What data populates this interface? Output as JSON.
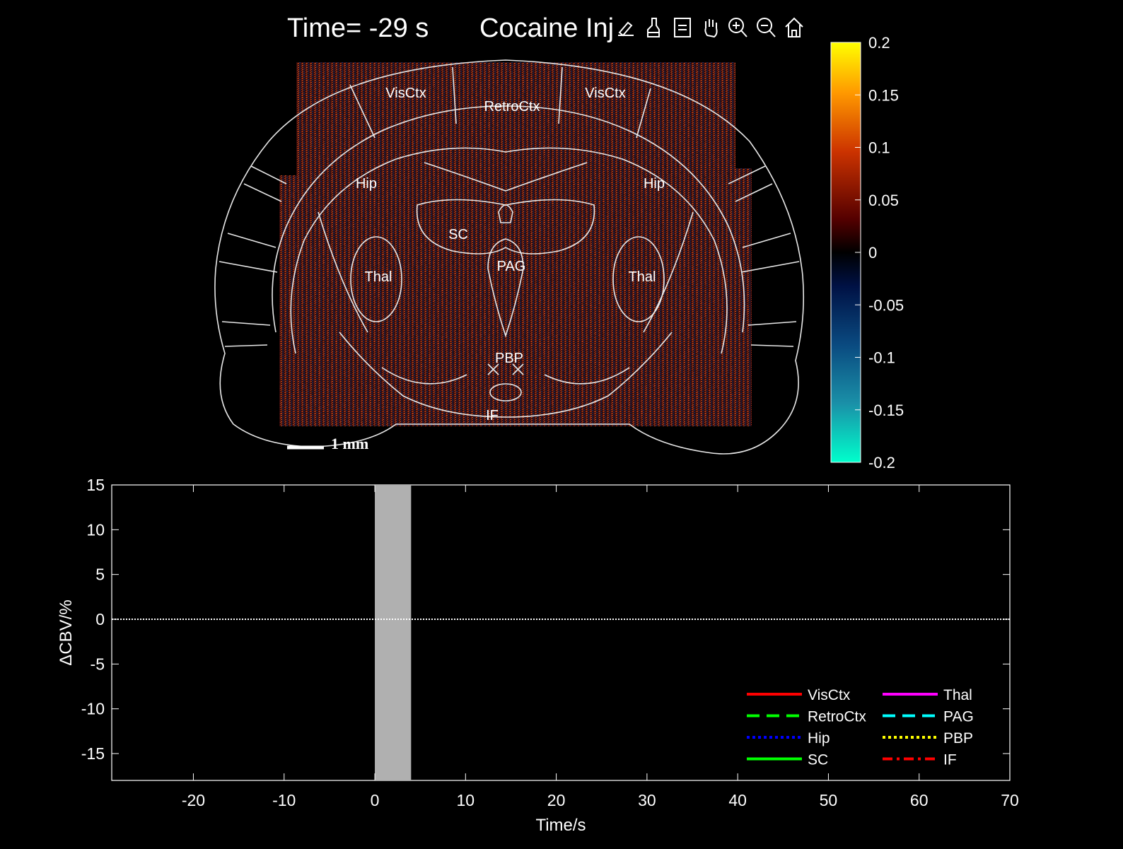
{
  "header": {
    "time_label": "Time= -29 s",
    "title": "Cocaine Inj"
  },
  "toolbar": {
    "icons": [
      "annotate-icon",
      "brush-icon",
      "datatip-icon",
      "pan-hand-icon",
      "zoom-in-icon",
      "zoom-out-icon",
      "home-icon"
    ]
  },
  "brain_map": {
    "regions": [
      "VisCtx",
      "RetroCtx",
      "VisCtx",
      "Hip",
      "Hip",
      "SC",
      "PAG",
      "Thal",
      "Thal",
      "PBP",
      "IF"
    ],
    "scale_bar": "1 mm"
  },
  "colorbar": {
    "min": -0.2,
    "max": 0.2,
    "ticks": [
      "0.2",
      "0.15",
      "0.1",
      "0.05",
      "0",
      "-0.05",
      "-0.1",
      "-0.15",
      "-0.2"
    ],
    "colors_top_to_bottom": [
      "#ffff00",
      "#ff9900",
      "#cc3300",
      "#550000",
      "#000000",
      "#001144",
      "#0a4a80",
      "#1a90a8",
      "#00ffcc"
    ]
  },
  "chart_data": {
    "type": "line",
    "xlabel": "Time/s",
    "ylabel": "ΔCBV/%",
    "xlim": [
      -29,
      70
    ],
    "ylim": [
      -18,
      15
    ],
    "xticks": [
      "-20",
      "-10",
      "0",
      "10",
      "20",
      "30",
      "40",
      "50",
      "60",
      "70"
    ],
    "xtick_values": [
      -20,
      -10,
      0,
      10,
      20,
      30,
      40,
      50,
      60,
      70
    ],
    "yticks": [
      "15",
      "10",
      "5",
      "0",
      "-5",
      "-10",
      "-15"
    ],
    "ytick_values": [
      15,
      10,
      5,
      0,
      -5,
      -10,
      -15
    ],
    "injection_window": [
      0,
      4
    ],
    "zero_line": 0,
    "grid": false,
    "legend_placement": "bottom-right",
    "series": [
      {
        "name": "VisCtx",
        "color": "#ff0000",
        "style": "solid",
        "x": [],
        "values": []
      },
      {
        "name": "RetroCtx",
        "color": "#00ff00",
        "style": "dashed",
        "x": [],
        "values": []
      },
      {
        "name": "Hip",
        "color": "#0000ff",
        "style": "dotted",
        "x": [],
        "values": []
      },
      {
        "name": "SC",
        "color": "#00ff00",
        "style": "solid",
        "x": [],
        "values": []
      },
      {
        "name": "Thal",
        "color": "#ff00ff",
        "style": "solid",
        "x": [],
        "values": []
      },
      {
        "name": "PAG",
        "color": "#00ffff",
        "style": "dashed",
        "x": [],
        "values": []
      },
      {
        "name": "PBP",
        "color": "#ffff00",
        "style": "dotted",
        "x": [],
        "values": []
      },
      {
        "name": "IF",
        "color": "#ff0000",
        "style": "dashdot",
        "x": [],
        "values": []
      }
    ]
  }
}
